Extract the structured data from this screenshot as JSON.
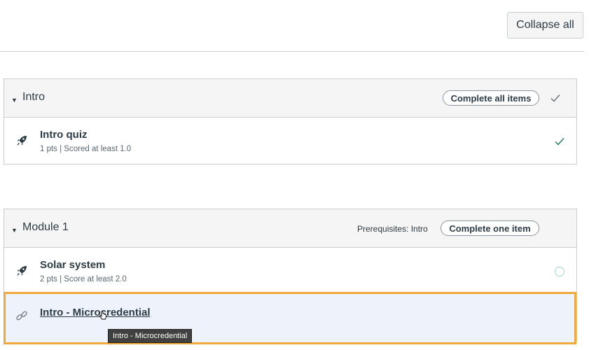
{
  "toolbar": {
    "collapse_label": "Collapse all"
  },
  "modules": [
    {
      "title": "Intro",
      "requirement": "Complete all items",
      "prerequisites": "",
      "items": [
        {
          "title": "Intro quiz",
          "meta": "1 pts  |  Scored at least 1.0",
          "icon": "rocket-icon",
          "status": "complete"
        }
      ]
    },
    {
      "title": "Module 1",
      "requirement": "Complete one item",
      "prerequisites": "Prerequisites: Intro",
      "items": [
        {
          "title": "Solar system",
          "meta": "2 pts  |  Score at least 2.0",
          "icon": "rocket-icon",
          "status": "incomplete"
        },
        {
          "title": "Intro - Microcredential",
          "icon": "link-icon",
          "status": "hovered"
        }
      ]
    }
  ],
  "tooltip": {
    "text": "Intro - Microcredential"
  },
  "colors": {
    "highlight_border": "#f2a93b",
    "check": "#2a7f62",
    "circle": "#9fd6d0"
  }
}
